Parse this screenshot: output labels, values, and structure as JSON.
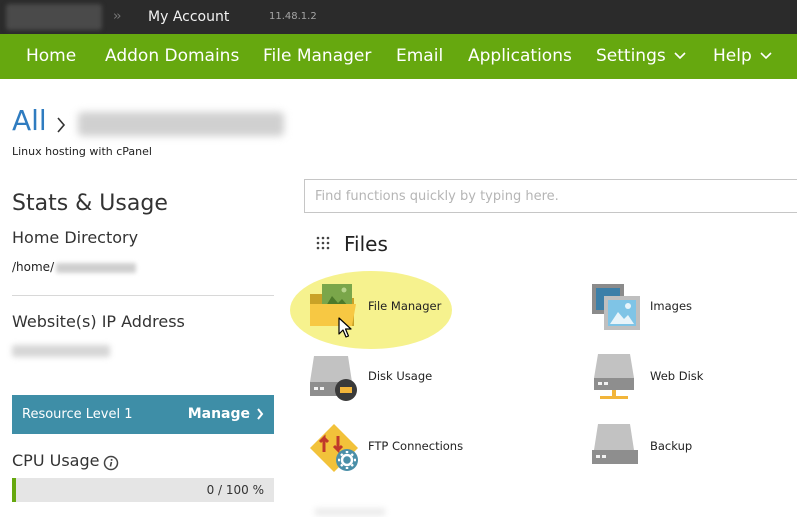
{
  "topbar": {
    "chevrons": "››",
    "title": "My Account",
    "ip": "11.48.1.2"
  },
  "nav": {
    "items": [
      {
        "label": "Home"
      },
      {
        "label": "Addon Domains"
      },
      {
        "label": "File Manager"
      },
      {
        "label": "Email"
      },
      {
        "label": "Applications"
      },
      {
        "label": "Settings",
        "icon": "chevron-down-icon"
      },
      {
        "label": "Help",
        "icon": "chevron-down-icon"
      }
    ]
  },
  "breadcrumb": {
    "root": "All",
    "subtitle": "Linux hosting with cPanel"
  },
  "stats": {
    "title": "Stats & Usage",
    "home_dir_label": "Home Directory",
    "home_dir_prefix": "/home/",
    "ip_label": "Website(s) IP Address",
    "resource_level": "Resource Level 1",
    "manage_label": "Manage",
    "cpu_label": "CPU Usage",
    "cpu_value": "0 / 100 %",
    "cpu_fraction": 0.0
  },
  "search": {
    "placeholder": "Find functions quickly by typing here."
  },
  "files": {
    "title": "Files",
    "tools": [
      {
        "label": "File Manager",
        "icon": "file-manager-icon"
      },
      {
        "label": "Images",
        "icon": "images-icon"
      },
      {
        "label": "Disk Usage",
        "icon": "disk-usage-icon"
      },
      {
        "label": "Web Disk",
        "icon": "web-disk-icon"
      },
      {
        "label": "FTP Connections",
        "icon": "ftp-connections-icon"
      },
      {
        "label": "Backup",
        "icon": "backup-icon"
      }
    ]
  },
  "colors": {
    "nav_green": "#66a80f",
    "topbar": "#2b2b2b",
    "link_blue": "#2f7cc0",
    "resource_teal": "#3e8ea7",
    "highlight_yellow": "#f5f07a"
  }
}
